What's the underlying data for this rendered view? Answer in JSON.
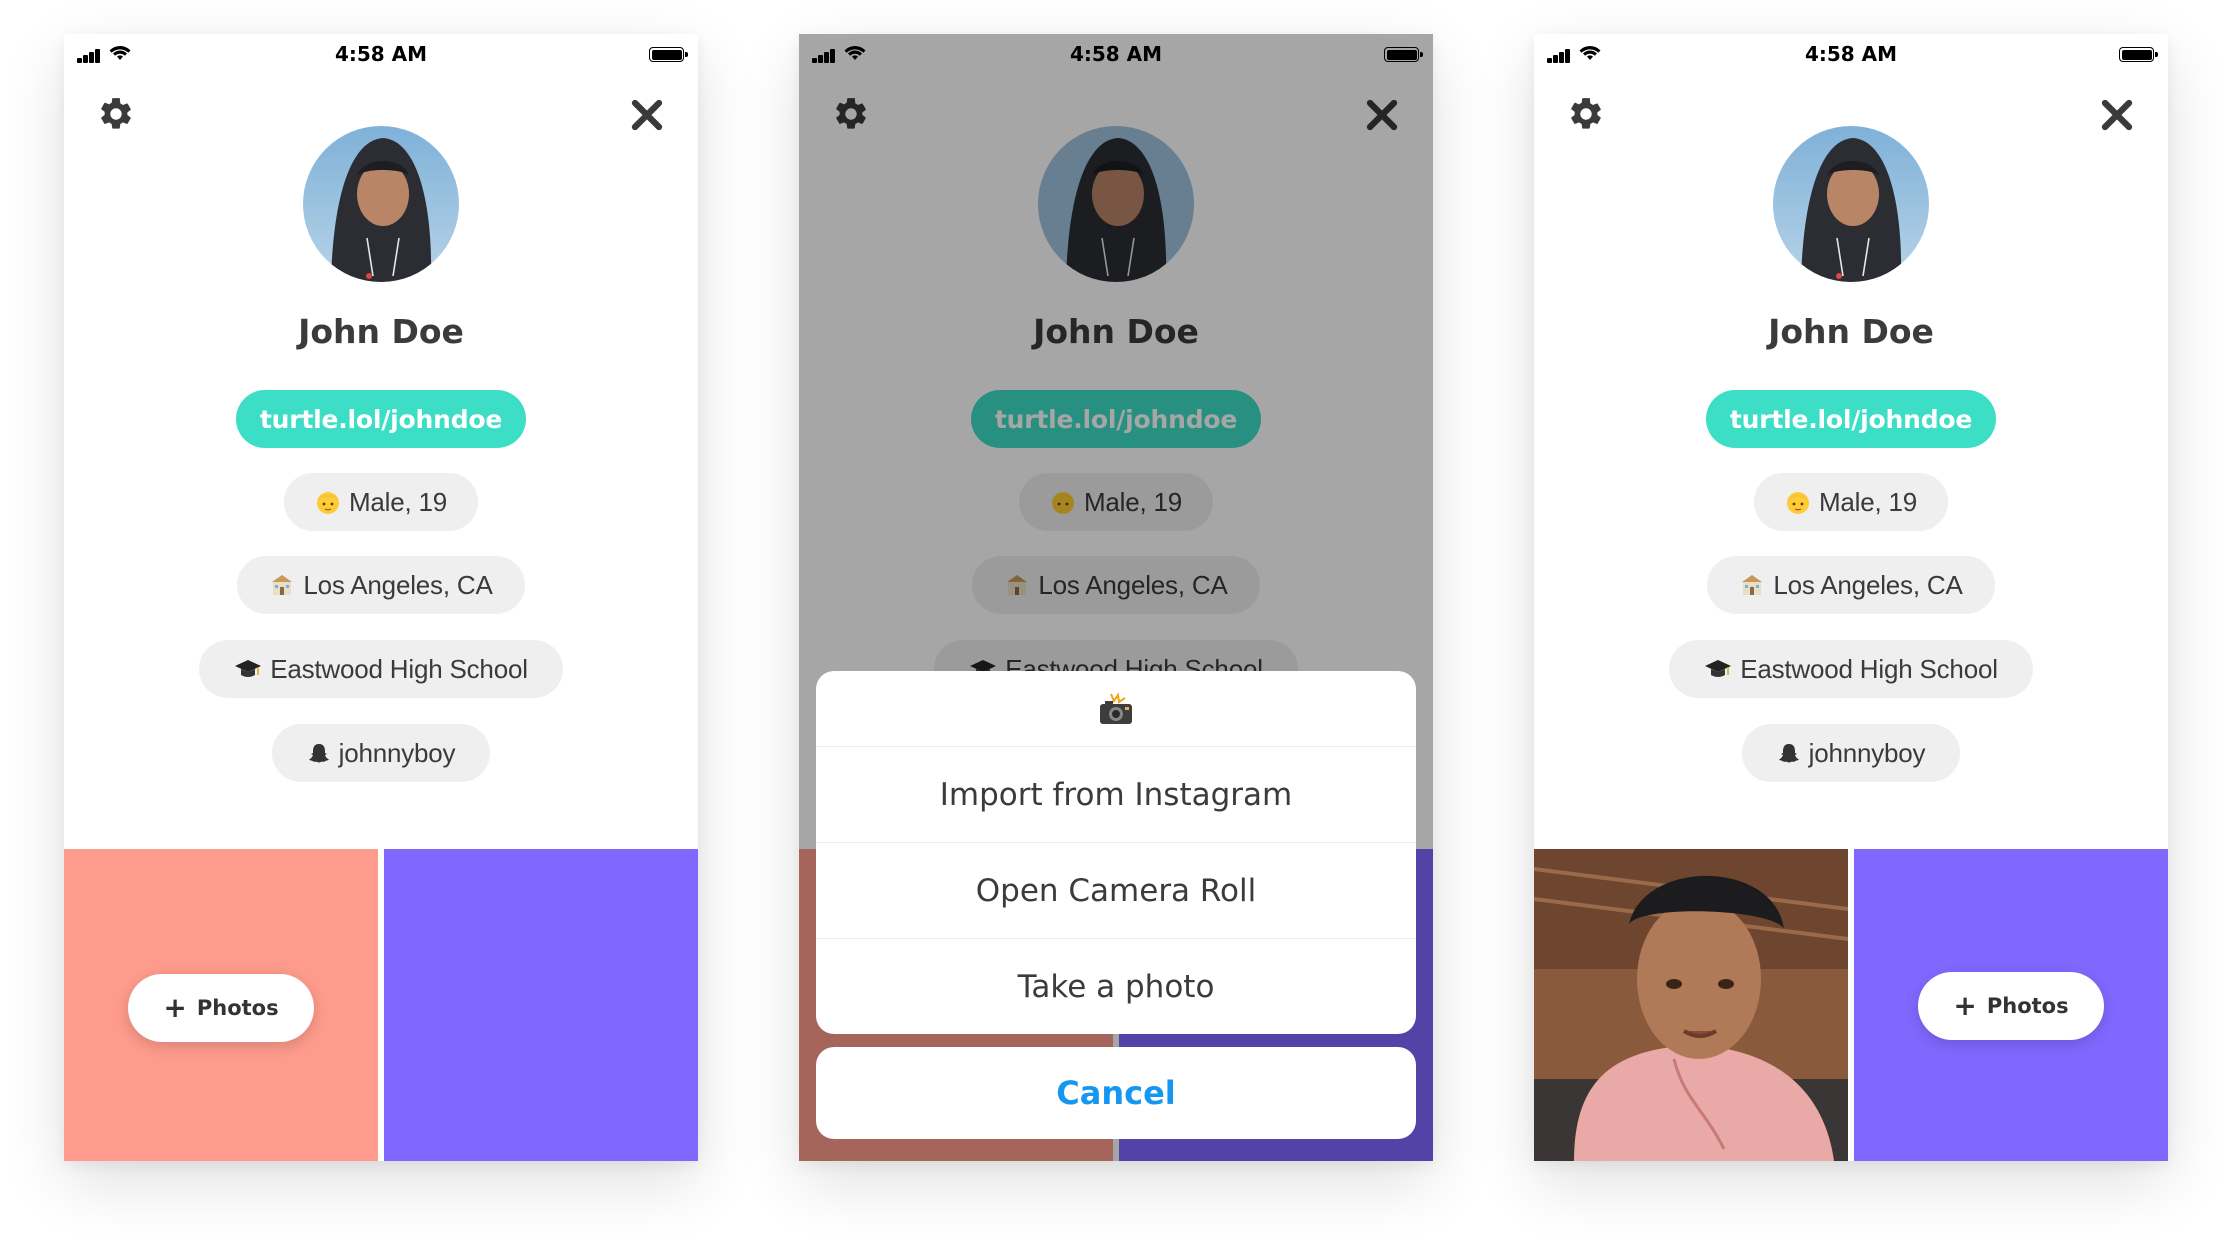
{
  "status": {
    "time": "4:58 AM"
  },
  "profile": {
    "name": "John Doe",
    "link": "turtle.lol/johndoe",
    "gender_age": "Male, 19",
    "location": "Los Angeles, CA",
    "school": "Eastwood High School",
    "snapchat": "johnnyboy"
  },
  "photos_button": {
    "label": "Photos"
  },
  "action_sheet": {
    "options": [
      "Import from Instagram",
      "Open Camera Roll",
      "Take a photo"
    ],
    "cancel": "Cancel"
  },
  "colors": {
    "accent": "#3ddec6",
    "tile_coral": "#fe9b8c",
    "tile_purple": "#8068ff",
    "cancel_blue": "#1596f0"
  }
}
